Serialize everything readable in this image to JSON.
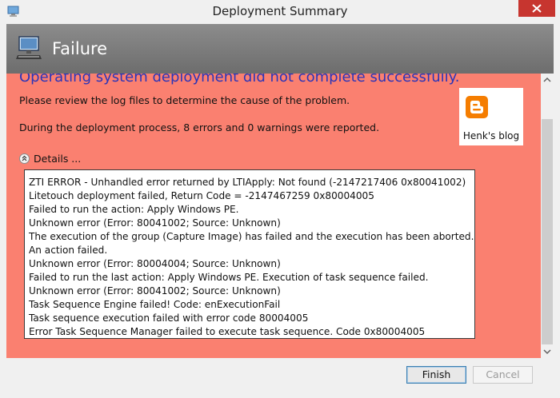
{
  "window": {
    "title": "Deployment Summary"
  },
  "header": {
    "status": "Failure"
  },
  "content": {
    "headline": "Operating system deployment did not complete successfully.",
    "message1": "Please review the log files to determine the cause of the problem.",
    "message2": "During the deployment process, 8 errors and 0 warnings were reported.",
    "details_label": "Details ...",
    "log_lines": [
      "ZTI ERROR - Unhandled error returned by LTIApply: Not found  (-2147217406  0x80041002)",
      "Litetouch deployment failed, Return Code = -2147467259  0x80004005",
      "Failed to run the action: Apply Windows PE.",
      "Unknown error (Error: 80041002; Source: Unknown)",
      "The execution of the group (Capture Image) has failed and the execution has been aborted.",
      "An action failed.",
      "Unknown error (Error: 80004004; Source: Unknown)",
      "Failed to run the last action: Apply Windows PE. Execution of task sequence failed.",
      "Unknown error (Error: 80041002; Source: Unknown)",
      "Task Sequence Engine failed! Code: enExecutionFail",
      "Task sequence execution failed with error code 80004005",
      "Error Task Sequence Manager failed to execute task sequence. Code 0x80004005"
    ]
  },
  "blog_badge": {
    "label": "Henk's blog",
    "icon": "blogger-icon"
  },
  "buttons": {
    "finish": "Finish",
    "cancel": "Cancel"
  },
  "colors": {
    "content_bg": "#fa8070",
    "headline": "#2b34b8",
    "header_bg": "#7d7d7d",
    "close_button": "#c7352f",
    "blogger_orange": "#f57d00"
  }
}
